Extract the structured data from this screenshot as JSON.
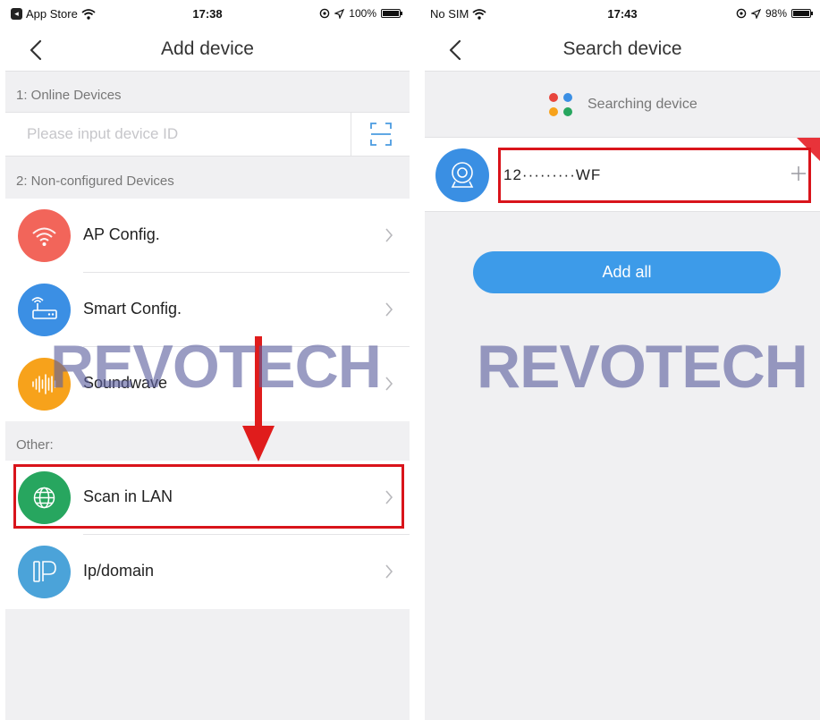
{
  "left_screen": {
    "status": {
      "carrier": "App Store",
      "time": "17:38",
      "battery": "100%",
      "battery_fraction": 1.0
    },
    "nav": {
      "title": "Add device"
    },
    "sections": {
      "online": "1: Online Devices",
      "nonconfigured": "2: Non-configured Devices",
      "other": "Other:"
    },
    "device_id_input": {
      "placeholder": "Please input device ID",
      "value": ""
    },
    "menu": {
      "ap_config": {
        "label": "AP Config.",
        "icon": "wifi-icon",
        "color": "#f2655a"
      },
      "smart_config": {
        "label": "Smart Config.",
        "icon": "router-icon",
        "color": "#3b8fe4"
      },
      "soundwave": {
        "label": "Soundwave",
        "icon": "soundwave-icon",
        "color": "#f7a21b"
      },
      "scan_lan": {
        "label": "Scan in LAN",
        "icon": "globe-icon",
        "color": "#27a65f"
      },
      "ip_domain": {
        "label": "Ip/domain",
        "icon": "ip-icon",
        "color": "#4ba3d9"
      }
    }
  },
  "right_screen": {
    "status": {
      "carrier": "No SIM",
      "time": "17:43",
      "battery": "98%",
      "battery_fraction": 0.98
    },
    "nav": {
      "title": "Search device"
    },
    "searching_text": "Searching device",
    "device": {
      "id": "12·········WF",
      "icon": "camera-icon",
      "badge_color": "#e8333a"
    },
    "add_all_label": "Add all"
  },
  "watermark": "REVOTECH",
  "colors": {
    "accent_blue": "#3d9be9",
    "highlight_red": "#d9141b",
    "background_gray": "#f0f0f2"
  }
}
